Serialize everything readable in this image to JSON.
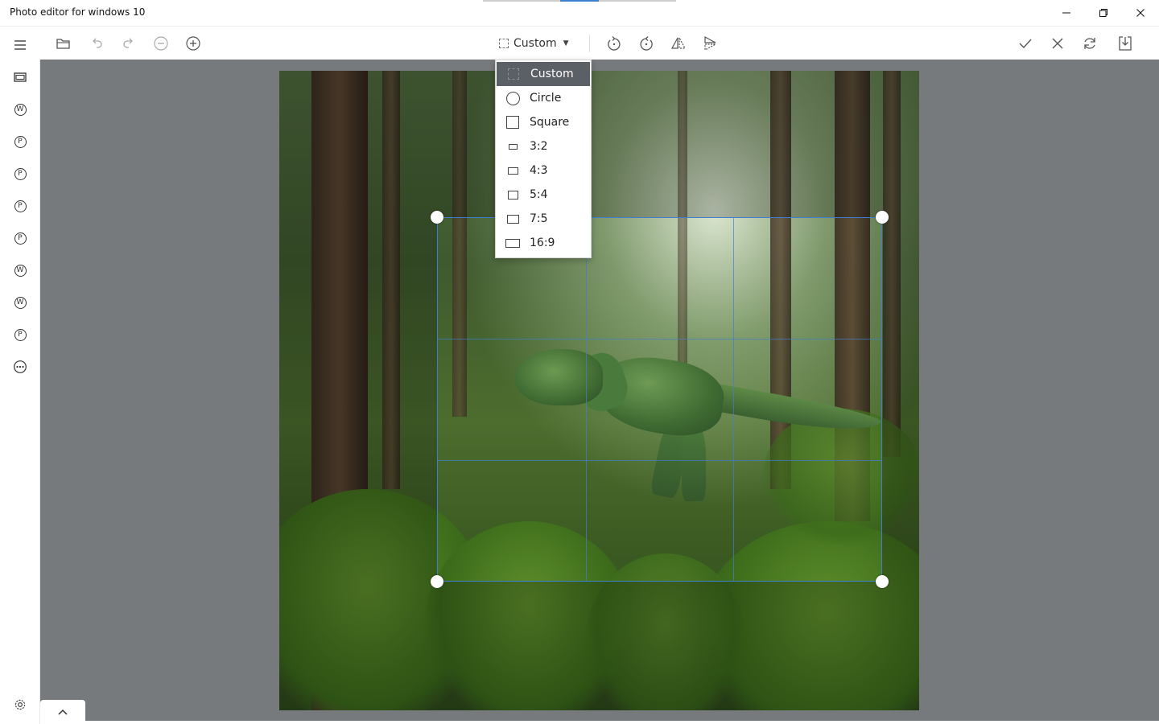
{
  "window": {
    "title": "Photo editor for windows 10",
    "controls": [
      "minimize",
      "restore",
      "close"
    ]
  },
  "toolbar": {
    "left_icons": [
      "folder-open-icon",
      "undo-icon",
      "redo-icon",
      "zoom-out-icon",
      "zoom-in-icon"
    ],
    "crop_ratio": {
      "label": "Custom"
    },
    "transform_icons": [
      "rotate-left-icon",
      "rotate-right-icon",
      "flip-horizontal-icon",
      "flip-vertical-icon"
    ],
    "right_icons": [
      "apply-check-icon",
      "cancel-x-icon",
      "reset-icon",
      "save-icon"
    ]
  },
  "sidebar": {
    "items": [
      {
        "icon": "menu-icon"
      },
      {
        "icon": "frames-icon"
      },
      {
        "icon": "circle-w-icon",
        "letter": "W"
      },
      {
        "icon": "circle-p-icon",
        "letter": "P"
      },
      {
        "icon": "circle-p-icon",
        "letter": "P"
      },
      {
        "icon": "circle-p-icon",
        "letter": "P"
      },
      {
        "icon": "circle-p-icon",
        "letter": "P"
      },
      {
        "icon": "circle-w-icon",
        "letter": "W"
      },
      {
        "icon": "circle-w-icon",
        "letter": "W"
      },
      {
        "icon": "circle-p-icon",
        "letter": "P"
      },
      {
        "icon": "more-icon"
      }
    ],
    "settings_icon": "settings-gear-icon"
  },
  "dropdown": {
    "items": [
      {
        "label": "Custom",
        "shape": "dashed-square",
        "selected": true
      },
      {
        "label": "Circle",
        "shape": "circle"
      },
      {
        "label": "Square",
        "shape": "square"
      },
      {
        "label": "3:2",
        "shape": "rect-3-2"
      },
      {
        "label": "4:3",
        "shape": "rect-4-3"
      },
      {
        "label": "5:4",
        "shape": "rect-5-4"
      },
      {
        "label": "7:5",
        "shape": "rect-7-5"
      },
      {
        "label": "16:9",
        "shape": "rect-16-9"
      }
    ]
  },
  "canvas": {
    "image_subject": "dinosaur-forest-image",
    "background_color": "#777a7d",
    "crop_color": "#3f7fd1"
  },
  "expander": {
    "icon": "chevron-up-icon"
  }
}
